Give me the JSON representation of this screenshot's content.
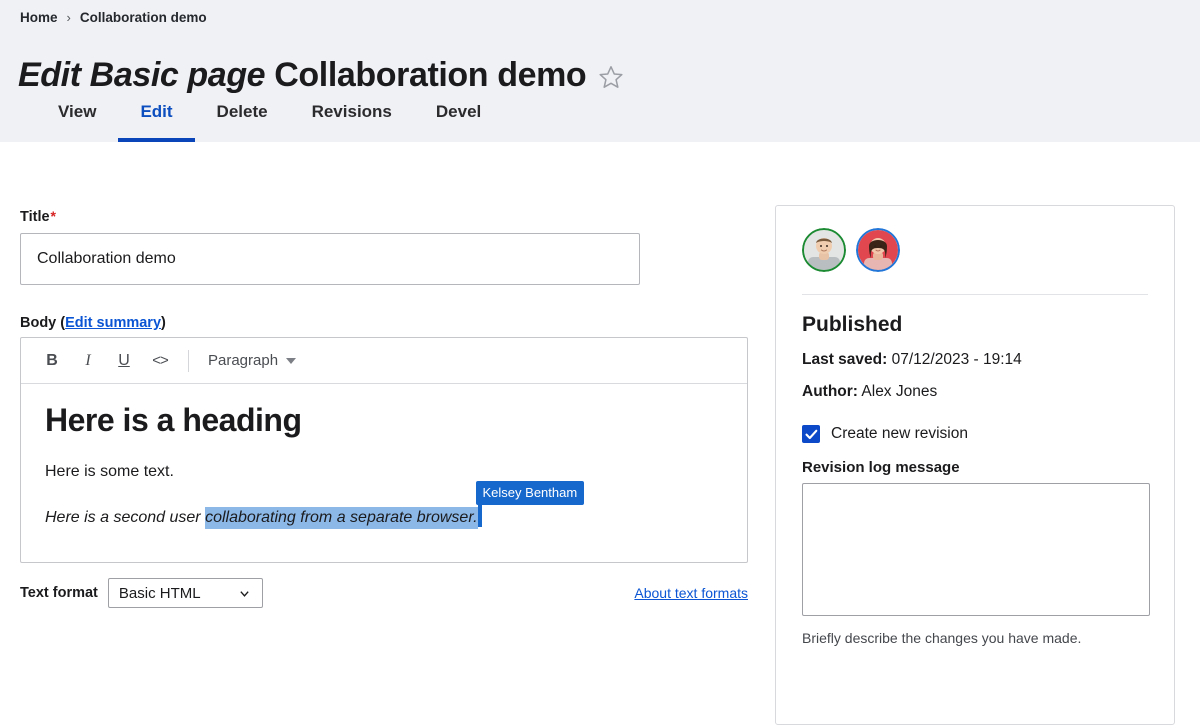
{
  "breadcrumb": {
    "home": "Home",
    "separator": "›",
    "current": "Collaboration demo"
  },
  "header": {
    "title_em": "Edit Basic page",
    "title_rest": "Collaboration demo",
    "star_icon": "star-outline-icon"
  },
  "tabs": [
    {
      "label": "View",
      "active": false
    },
    {
      "label": "Edit",
      "active": true
    },
    {
      "label": "Delete",
      "active": false
    },
    {
      "label": "Revisions",
      "active": false
    },
    {
      "label": "Devel",
      "active": false
    }
  ],
  "form": {
    "title_label": "Title",
    "title_required_marker": "*",
    "title_value": "Collaboration demo",
    "title_placeholder": "",
    "body_label_prefix": "Body (",
    "body_label_link": "Edit summary",
    "body_label_suffix": ")",
    "toolbar": {
      "bold": "B",
      "italic": "I",
      "underline": "U",
      "source": "<>",
      "paragraph_style": "Paragraph"
    },
    "editor": {
      "heading": "Here is a heading",
      "paragraph_1": "Here is some text.",
      "paragraph_2_prefix": "Here is a second user ",
      "paragraph_2_selected": "collaborating from a separate browser.",
      "collaborator_name": "Kelsey Bentham"
    },
    "text_format_label": "Text format",
    "text_format_value": "Basic HTML",
    "about_text_formats": "About text formats"
  },
  "sidebar": {
    "avatars": [
      {
        "name": "avatar-alex-jones",
        "ring_color": "#1b8a32"
      },
      {
        "name": "avatar-kelsey-bentham",
        "ring_color": "#2176d8"
      }
    ],
    "status": "Published",
    "last_saved_label": "Last saved:",
    "last_saved_value": "07/12/2023 - 19:14",
    "author_label": "Author:",
    "author_value": "Alex Jones",
    "create_new_revision_label": "Create new revision",
    "create_new_revision_checked": true,
    "revision_log_label": "Revision log message",
    "revision_log_value": "",
    "revision_log_hint": "Briefly describe the changes you have made."
  },
  "colors": {
    "header_bg": "#f0f1f5",
    "accent_blue": "#0a45ba",
    "link_blue": "#0b55d4",
    "selection_blue": "#8cb8e8",
    "collab_badge": "#1768cc",
    "required_red": "#d72222"
  }
}
